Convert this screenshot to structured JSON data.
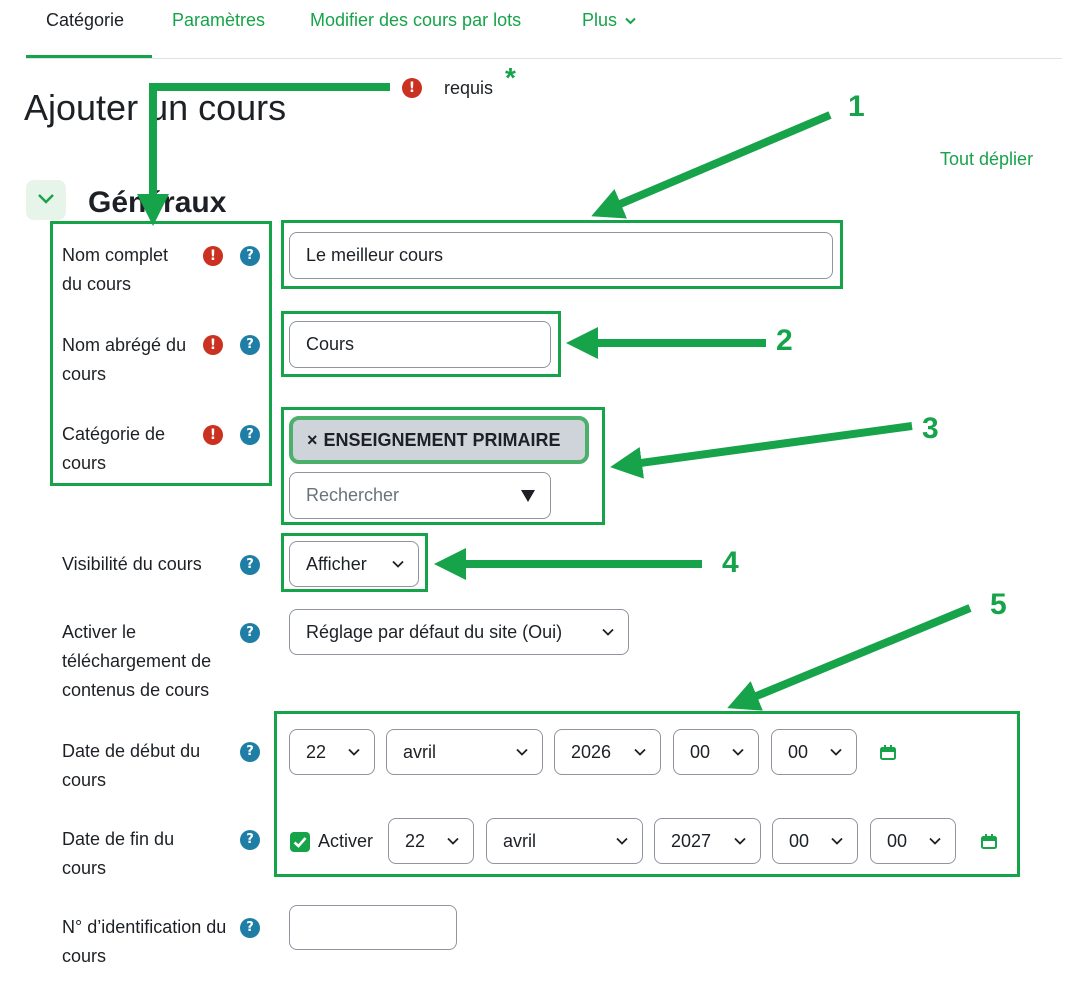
{
  "nav": {
    "tabs": [
      {
        "label": "Catégorie"
      },
      {
        "label": "Paramètres"
      },
      {
        "label": "Modifier des cours par lots"
      },
      {
        "label": "Plus"
      }
    ]
  },
  "page": {
    "title": "Ajouter un cours",
    "required_legend": "requis",
    "required_star": "*",
    "expand_all": "Tout déplier"
  },
  "section": {
    "title": "Généraux"
  },
  "fields": {
    "fullname": {
      "label": "Nom complet du cours",
      "value": "Le meilleur cours"
    },
    "shortname": {
      "label": "Nom abrégé du cours",
      "value": "Cours"
    },
    "category": {
      "label": "Catégorie de cours",
      "selected": "ENSEIGNEMENT PRIMAIRE",
      "remove": "×",
      "search_placeholder": "Rechercher"
    },
    "visibility": {
      "label": "Visibilité du cours",
      "value": "Afficher"
    },
    "download": {
      "label": "Activer le téléchargement de contenus de cours",
      "value": "Réglage par défaut du site (Oui)"
    },
    "startdate": {
      "label": "Date de début du cours",
      "day": "22",
      "month": "avril",
      "year": "2026",
      "hour": "00",
      "minute": "00"
    },
    "enddate": {
      "label": "Date de fin du cours",
      "enable_label": "Activer",
      "enabled": true,
      "day": "22",
      "month": "avril",
      "year": "2027",
      "hour": "00",
      "minute": "00"
    },
    "idnumber": {
      "label": "N° d’identification du cours",
      "value": ""
    }
  },
  "annotations": {
    "n1": "1",
    "n2": "2",
    "n3": "3",
    "n4": "4",
    "n5": "5"
  },
  "colors": {
    "accent": "#16a34a",
    "required": "#ca3120",
    "help": "#1f7ea6"
  },
  "icons": [
    "required-icon",
    "help-icon",
    "chevron-down-icon",
    "calendar-icon",
    "checkbox-checked-icon"
  ]
}
